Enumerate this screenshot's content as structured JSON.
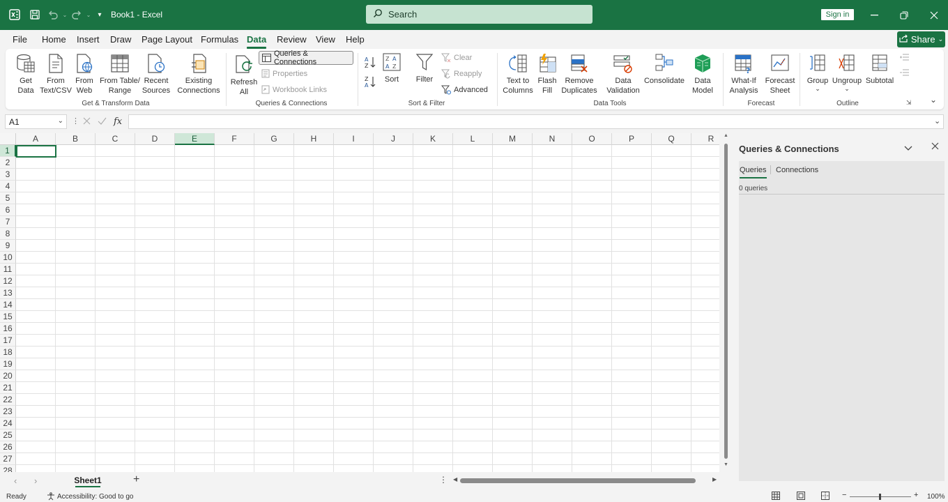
{
  "app": {
    "title": "Book1  -  Excel",
    "accent": "#1a7343"
  },
  "titlebar": {
    "search_placeholder": "Search",
    "signin_label": "Sign in"
  },
  "menu": {
    "tabs": [
      "File",
      "Home",
      "Insert",
      "Draw",
      "Page Layout",
      "Formulas",
      "Data",
      "Review",
      "View",
      "Help"
    ],
    "active": "Data",
    "share_label": "Share"
  },
  "ribbon": {
    "get_transform": {
      "label": "Get & Transform Data",
      "get_data": "Get\nData",
      "from_text": "From\nText/CSV",
      "from_web": "From\nWeb",
      "from_table": "From Table/\nRange",
      "recent": "Recent\nSources",
      "existing": "Existing\nConnections"
    },
    "queries": {
      "label": "Queries & Connections",
      "refresh": "Refresh\nAll",
      "qc": "Queries & Connections",
      "properties": "Properties",
      "links": "Workbook Links"
    },
    "sortfilter": {
      "label": "Sort & Filter",
      "sort": "Sort",
      "filter": "Filter",
      "clear": "Clear",
      "reapply": "Reapply",
      "advanced": "Advanced"
    },
    "datatools": {
      "label": "Data Tools",
      "text_to_columns": "Text to\nColumns",
      "flash_fill": "Flash\nFill",
      "remove_dups": "Remove\nDuplicates",
      "validation": "Data\nValidation",
      "consolidate": "Consolidate",
      "data_model": "Data\nModel"
    },
    "forecast": {
      "label": "Forecast",
      "whatif": "What-If\nAnalysis",
      "sheet": "Forecast\nSheet"
    },
    "outline": {
      "label": "Outline",
      "group": "Group",
      "ungroup": "Ungroup",
      "subtotal": "Subtotal"
    }
  },
  "formula_bar": {
    "namebox": "A1",
    "fx": "fx",
    "value": ""
  },
  "grid": {
    "columns": [
      "A",
      "B",
      "C",
      "D",
      "E",
      "F",
      "G",
      "H",
      "I",
      "J",
      "K",
      "L",
      "M",
      "N",
      "O",
      "P",
      "Q",
      "R"
    ],
    "rows": [
      "1",
      "2",
      "3",
      "4",
      "5",
      "6",
      "7",
      "8",
      "9",
      "10",
      "11",
      "12",
      "13",
      "14",
      "15",
      "16",
      "17",
      "18",
      "19",
      "20",
      "21",
      "22",
      "23",
      "24",
      "25",
      "26",
      "27",
      "28"
    ],
    "selected_column": "E",
    "selected_row": "1"
  },
  "sheets": {
    "tabs": [
      "Sheet1"
    ],
    "add_label": "+"
  },
  "status": {
    "ready": "Ready",
    "accessibility": "Accessibility: Good to go",
    "zoom": "100%"
  },
  "pane": {
    "title": "Queries & Connections",
    "tabs": [
      "Queries",
      "Connections"
    ],
    "count_text": "0 queries"
  }
}
